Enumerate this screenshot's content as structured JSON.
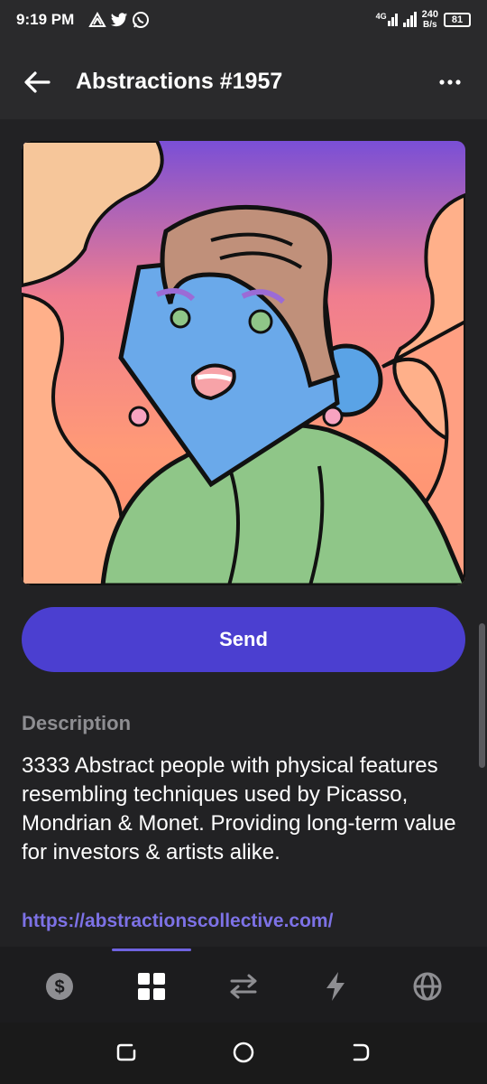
{
  "status_bar": {
    "time": "9:19 PM",
    "network": "4G",
    "speed_value": "240",
    "speed_unit": "B/s",
    "battery": "81",
    "icons": [
      "drive-icon",
      "twitter-icon",
      "whatsapp-icon"
    ]
  },
  "header": {
    "title": "Abstractions #1957",
    "back_icon": "arrow-left-icon",
    "menu_icon": "more-horizontal-icon"
  },
  "main": {
    "send_label": "Send",
    "description_heading": "Description",
    "description_text": "3333 Abstract people with physical features resembling techniques used by Picasso, Mondrian & Monet. Providing long-term value for investors & artists alike.",
    "link": "https://abstractionscollective.com/"
  },
  "bottom_nav": {
    "items": [
      {
        "icon": "dollar-icon",
        "active": false
      },
      {
        "icon": "grid-icon",
        "active": true
      },
      {
        "icon": "swap-icon",
        "active": false
      },
      {
        "icon": "bolt-icon",
        "active": false
      },
      {
        "icon": "globe-icon",
        "active": false
      }
    ]
  },
  "colors": {
    "accent": "#4b3fd0",
    "link": "#7d72e6",
    "background": "#222224"
  }
}
